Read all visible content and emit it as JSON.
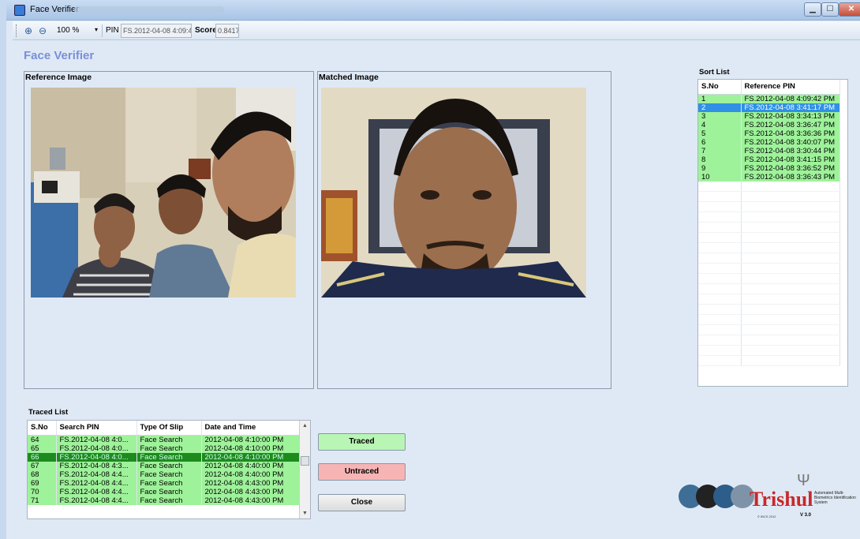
{
  "window": {
    "title": "Face Verifier"
  },
  "toolbar": {
    "zoom": "100 %",
    "pin_label": "PIN",
    "pin_value": "FS.2012-04-08 4:09:4",
    "score_label": "Score",
    "score_value": "0.8417"
  },
  "heading": "Face Verifier",
  "reference": {
    "title": "Reference Image"
  },
  "matched": {
    "title": "Matched Image"
  },
  "sort_list": {
    "title": "Sort List",
    "columns": [
      "S.No",
      "Reference PIN"
    ],
    "rows": [
      {
        "sno": "1",
        "pin": "FS.2012-04-08 4:09:42 PM",
        "state": "g"
      },
      {
        "sno": "2",
        "pin": "FS.2012-04-08 3:41:17 PM",
        "state": "sel"
      },
      {
        "sno": "3",
        "pin": "FS.2012-04-08 3:34:13 PM",
        "state": "g"
      },
      {
        "sno": "4",
        "pin": "FS.2012-04-08 3:36:47 PM",
        "state": "g"
      },
      {
        "sno": "5",
        "pin": "FS.2012-04-08 3:36:36 PM",
        "state": "g"
      },
      {
        "sno": "6",
        "pin": "FS.2012-04-08 3:40:07 PM",
        "state": "g"
      },
      {
        "sno": "7",
        "pin": "FS.2012-04-08 3:30:44 PM",
        "state": "g"
      },
      {
        "sno": "8",
        "pin": "FS.2012-04-08 3:41:15 PM",
        "state": "g"
      },
      {
        "sno": "9",
        "pin": "FS.2012-04-08 3:36:52 PM",
        "state": "g"
      },
      {
        "sno": "10",
        "pin": "FS.2012-04-08 3:36:43 PM",
        "state": "g"
      }
    ]
  },
  "traced_list": {
    "title": "Traced List",
    "columns": [
      "S.No",
      "Search PIN",
      "Type Of Slip",
      "Date and Time"
    ],
    "rows": [
      {
        "sno": "64",
        "pin": "FS.2012-04-08 4:0...",
        "type": "Face Search",
        "dt": "2012-04-08 4:10:00 PM",
        "state": "g"
      },
      {
        "sno": "65",
        "pin": "FS.2012-04-08 4:0...",
        "type": "Face Search",
        "dt": "2012-04-08 4:10:00 PM",
        "state": "g"
      },
      {
        "sno": "66",
        "pin": "FS.2012-04-08 4:0...",
        "type": "Face Search",
        "dt": "2012-04-08 4:10:00 PM",
        "state": "dsel"
      },
      {
        "sno": "67",
        "pin": "FS.2012-04-08 4:3...",
        "type": "Face Search",
        "dt": "2012-04-08 4:40:00 PM",
        "state": "g"
      },
      {
        "sno": "68",
        "pin": "FS.2012-04-08 4:4...",
        "type": "Face Search",
        "dt": "2012-04-08 4:40:00 PM",
        "state": "g"
      },
      {
        "sno": "69",
        "pin": "FS.2012-04-08 4:4...",
        "type": "Face Search",
        "dt": "2012-04-08 4:43:00 PM",
        "state": "g"
      },
      {
        "sno": "70",
        "pin": "FS.2012-04-08 4:4...",
        "type": "Face Search",
        "dt": "2012-04-08 4:43:00 PM",
        "state": "g"
      },
      {
        "sno": "71",
        "pin": "FS.2012-04-08 4:4...",
        "type": "Face Search",
        "dt": "2012-04-08 4:43:00 PM",
        "state": "g"
      }
    ]
  },
  "buttons": {
    "traced": "Traced",
    "untraced": "Untraced",
    "close": "Close"
  },
  "logo": {
    "brand": "Trishul",
    "subtitle": "Automated Multi-Biometrics Identification System",
    "copyright": "© IBCS 2012",
    "version": "V 3.0"
  },
  "icons": {
    "zoom_in": "zoom-in-icon",
    "zoom_out": "zoom-out-icon",
    "dropdown": "chevron-down-icon"
  },
  "colors": {
    "row_green": "#9ef29a",
    "row_selected": "#2f90e6",
    "row_dark_selected": "#1d8a1d",
    "heading": "#7a8fd8",
    "traced_btn": "#b9f5b5",
    "untraced_btn": "#f7b4b4"
  }
}
